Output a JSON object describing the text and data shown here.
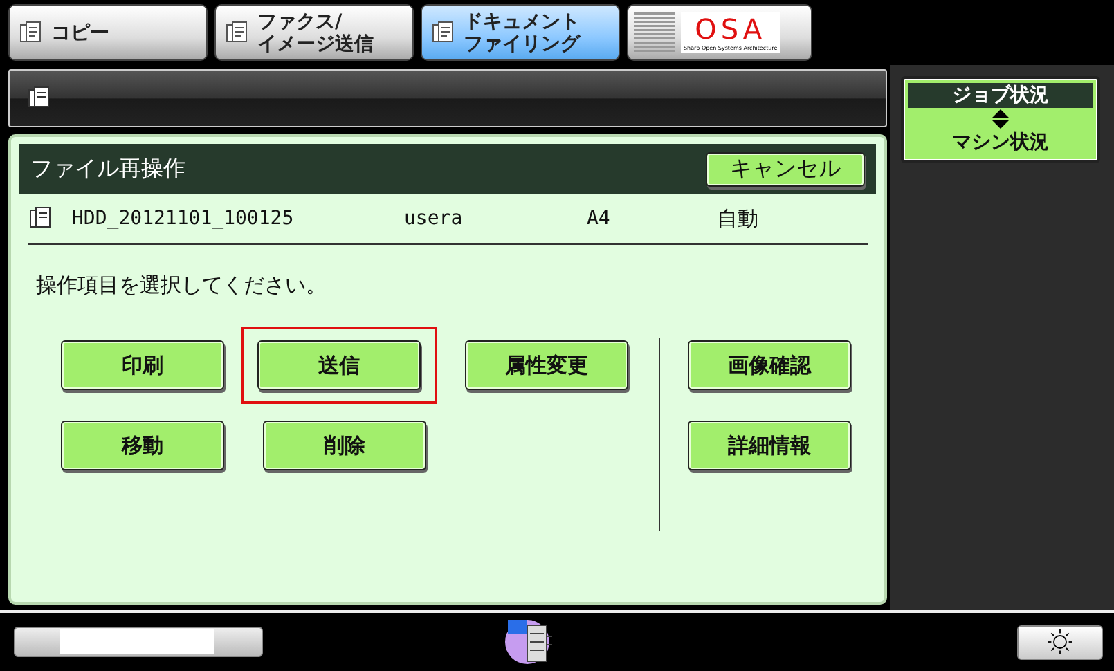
{
  "tabs": [
    {
      "lines": [
        "コピー"
      ],
      "selected": false
    },
    {
      "lines": [
        "ファクス/",
        "イメージ送信"
      ],
      "selected": false
    },
    {
      "lines": [
        "ドキュメント",
        "ファイリング"
      ],
      "selected": true
    }
  ],
  "logo": {
    "name": "OSA",
    "tagline": "Sharp Open Systems Architecture"
  },
  "panel": {
    "title": "ファイル再操作",
    "cancel": "キャンセル"
  },
  "file": {
    "name": "HDD_20121101_100125",
    "user": "usera",
    "size": "A4",
    "color_mode": "自動"
  },
  "instruction": "操作項目を選択してください。",
  "actions": [
    {
      "label": "印刷",
      "selected": false
    },
    {
      "label": "送信",
      "selected": true
    },
    {
      "label": "属性変更",
      "selected": false
    },
    {
      "label": "移動",
      "selected": false
    },
    {
      "label": "削除",
      "selected": false
    }
  ],
  "side_actions": [
    {
      "label": "画像確認",
      "selected": false
    },
    {
      "label": "詳細情報",
      "selected": false
    }
  ],
  "status_button": {
    "top": "ジョブ状況",
    "bottom": "マシン状況"
  }
}
